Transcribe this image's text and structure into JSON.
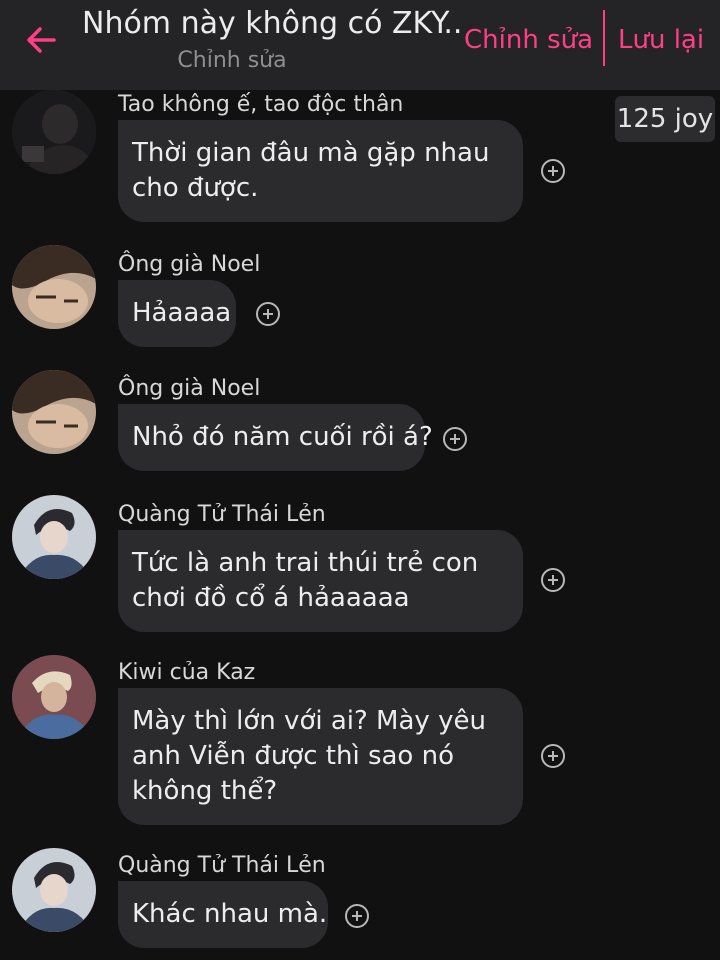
{
  "header": {
    "title": "Nhóm này không có ZKY...",
    "subtitle": "Chỉnh sửa",
    "edit_label": "Chỉnh sửa",
    "save_label": "Lưu lại",
    "accent": "#ff3e86"
  },
  "joy_badge": "125 joy",
  "icons": {
    "back": "arrow-left-icon",
    "add_reaction": "plus-circle-icon"
  },
  "messages": [
    {
      "sender": "Tao không ế, tao độc thân",
      "lines": [
        "Thời gian đâu mà gặp nhau",
        "cho được."
      ]
    },
    {
      "sender": "Ông già Noel",
      "lines": [
        "Hảaaaa"
      ]
    },
    {
      "sender": "Ông già Noel",
      "lines": [
        "Nhỏ đó năm cuối rồi á?"
      ]
    },
    {
      "sender": "Quàng Tử Thái Lẻn",
      "lines": [
        "Tức là anh trai thúi trẻ con",
        "chơi đồ cổ á hảaaaaa"
      ]
    },
    {
      "sender": "Kiwi của Kaz",
      "lines": [
        "Mày thì lớn với ai? Mày yêu",
        "anh Viễn được thì sao nó",
        "không thể?"
      ]
    },
    {
      "sender": "Quàng Tử Thái Lẻn",
      "lines": [
        "Khác nhau mà."
      ]
    }
  ]
}
